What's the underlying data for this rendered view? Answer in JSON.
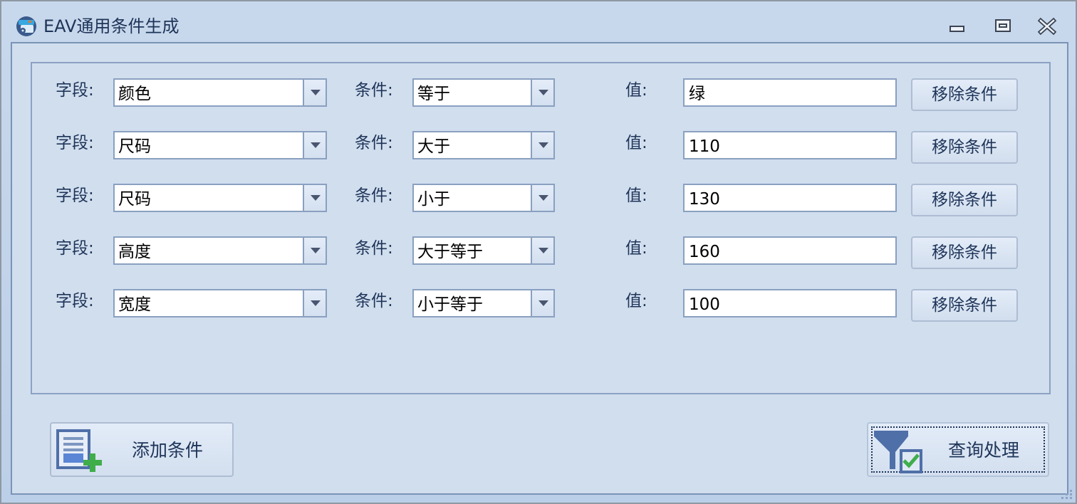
{
  "window": {
    "title": "EAV通用条件生成",
    "icon": "app-database-icon",
    "controls": [
      "minimize-icon",
      "restore-icon",
      "close-icon"
    ]
  },
  "labels": {
    "field": "字段:",
    "condition": "条件:",
    "value": "值:"
  },
  "rows": [
    {
      "field": "颜色",
      "condition": "等于",
      "value": "绿",
      "remove_label": "移除条件"
    },
    {
      "field": "尺码",
      "condition": "大于",
      "value": "110",
      "remove_label": "移除条件"
    },
    {
      "field": "尺码",
      "condition": "小于",
      "value": "130",
      "remove_label": "移除条件"
    },
    {
      "field": "高度",
      "condition": "大于等于",
      "value": "160",
      "remove_label": "移除条件"
    },
    {
      "field": "宽度",
      "condition": "小于等于",
      "value": "100",
      "remove_label": "移除条件"
    }
  ],
  "actions": {
    "add_label": "添加条件",
    "add_icon": "add-document-icon",
    "query_label": "查询处理",
    "query_icon": "filter-check-icon"
  },
  "colors": {
    "titlebar": "#c3d4ea",
    "client_bg": "#d1deee",
    "text": "#1e3458",
    "border": "#8aa0c0",
    "add_green": "#3fae4a",
    "icon_blue": "#4f6fa8"
  }
}
